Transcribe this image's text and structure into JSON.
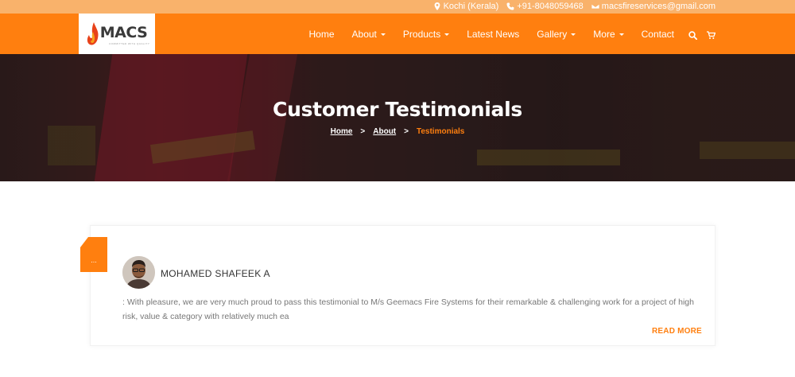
{
  "topbar": {
    "location": "Kochi (Kerala)",
    "phone": "+91-8048059468",
    "email": "macsfireservices@gmail.com"
  },
  "logo": {
    "text": "MACS",
    "tagline": "COMMITTED WITH QUALITY"
  },
  "nav": {
    "items": [
      {
        "label": "Home",
        "has_dropdown": false
      },
      {
        "label": "About",
        "has_dropdown": true
      },
      {
        "label": "Products",
        "has_dropdown": true
      },
      {
        "label": "Latest News",
        "has_dropdown": false
      },
      {
        "label": "Gallery",
        "has_dropdown": true
      },
      {
        "label": "More",
        "has_dropdown": true
      },
      {
        "label": "Contact",
        "has_dropdown": false
      }
    ],
    "icons": [
      "search-icon",
      "cart-icon"
    ]
  },
  "hero": {
    "title": "Customer Testimonials",
    "breadcrumb": {
      "home": "Home",
      "sep": ">",
      "about": "About",
      "current": "Testimonials"
    }
  },
  "testimonial": {
    "badge": "...",
    "name": "MOHAMED SHAFEEK A",
    "text": ": With pleasure, we are very much proud to pass this testimonial to M/s Geemacs Fire Systems for their remarkable & challenging work for a project of high risk, value & category with relatively much ea",
    "read_more": "READ MORE"
  },
  "colors": {
    "accent": "#ff7f0f",
    "topbar": "#f9b26b"
  }
}
